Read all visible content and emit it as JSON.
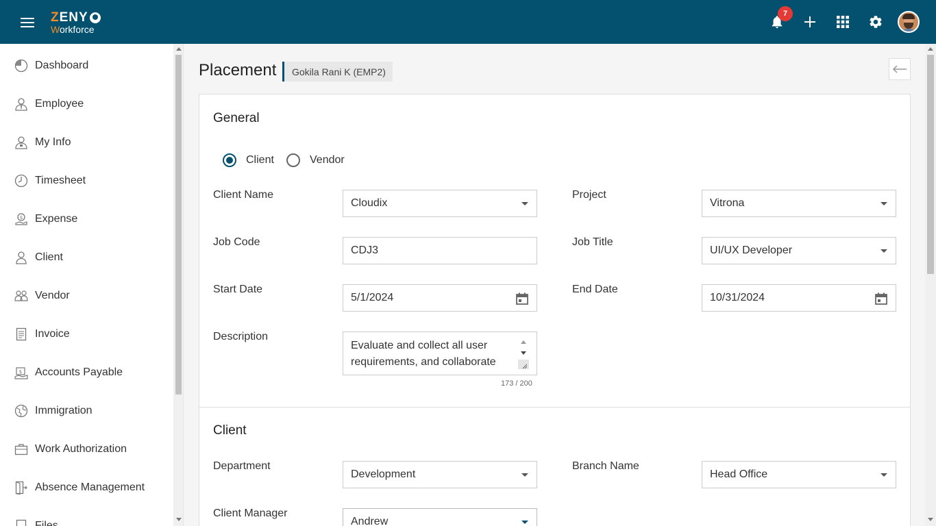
{
  "app": {
    "logo_line1": "ZENY",
    "logo_line2": "Workforce"
  },
  "header": {
    "notification_count": "7"
  },
  "sidebar": {
    "items": [
      {
        "label": "Dashboard",
        "icon": "dashboard-icon"
      },
      {
        "label": "Employee",
        "icon": "employee-icon"
      },
      {
        "label": "My Info",
        "icon": "my-info-icon"
      },
      {
        "label": "Timesheet",
        "icon": "clock-icon"
      },
      {
        "label": "Expense",
        "icon": "expense-icon"
      },
      {
        "label": "Client",
        "icon": "client-icon"
      },
      {
        "label": "Vendor",
        "icon": "vendor-icon"
      },
      {
        "label": "Invoice",
        "icon": "invoice-icon"
      },
      {
        "label": "Accounts Payable",
        "icon": "accounts-payable-icon"
      },
      {
        "label": "Immigration",
        "icon": "globe-icon"
      },
      {
        "label": "Work Authorization",
        "icon": "briefcase-icon"
      },
      {
        "label": "Absence Management",
        "icon": "exit-door-icon"
      },
      {
        "label": "Files",
        "icon": "files-icon"
      }
    ]
  },
  "page": {
    "title": "Placement",
    "employee_chip": "Gokila Rani K (EMP2)"
  },
  "general": {
    "title": "General",
    "type_options": [
      "Client",
      "Vendor"
    ],
    "selected_type": "Client",
    "client_name": {
      "label": "Client Name",
      "value": "Cloudix"
    },
    "project": {
      "label": "Project",
      "value": "Vitrona"
    },
    "job_code": {
      "label": "Job Code",
      "value": "CDJ3"
    },
    "job_title": {
      "label": "Job Title",
      "value": "UI/UX Developer"
    },
    "start_date": {
      "label": "Start Date",
      "value": "5/1/2024"
    },
    "end_date": {
      "label": "End Date",
      "value": "10/31/2024"
    },
    "description": {
      "label": "Description",
      "value": "Evaluate and collect all user requirements, and collaborate",
      "counter": "173 / 200"
    }
  },
  "client_section": {
    "title": "Client",
    "department": {
      "label": "Department",
      "value": "Development"
    },
    "branch_name": {
      "label": "Branch Name",
      "value": "Head Office"
    },
    "client_manager": {
      "label": "Client Manager",
      "value": "Andrew"
    }
  },
  "colors": {
    "primary": "#04506f",
    "accent": "#f28c28",
    "badge": "#e53935"
  }
}
